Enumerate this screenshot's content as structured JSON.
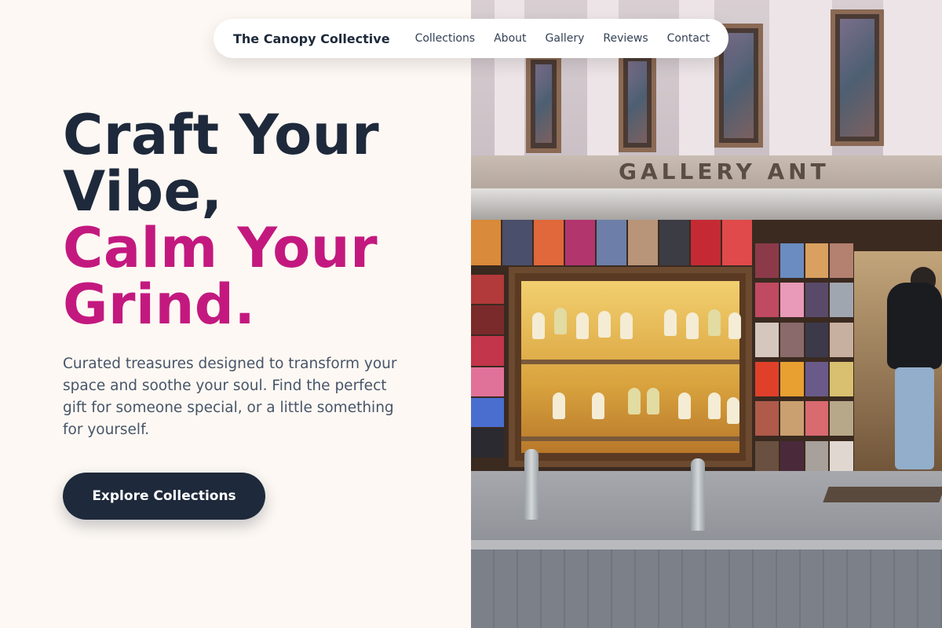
{
  "nav": {
    "brand": "The Canopy Collective",
    "links": [
      "Collections",
      "About",
      "Gallery",
      "Reviews",
      "Contact"
    ]
  },
  "hero": {
    "headline_line1": "Craft Your Vibe,",
    "headline_line2": "Calm Your Grind.",
    "description": "Curated treasures designed to transform your space and soothe your soul. Find the perfect gift for someone special, or a little something for yourself.",
    "cta_label": "Explore Collections"
  },
  "image": {
    "sign_text": "GALLERY ANT"
  },
  "colors": {
    "background": "#fdf8f3",
    "primary_dark": "#1e293b",
    "accent": "#c3197f",
    "body_text": "#475569"
  }
}
